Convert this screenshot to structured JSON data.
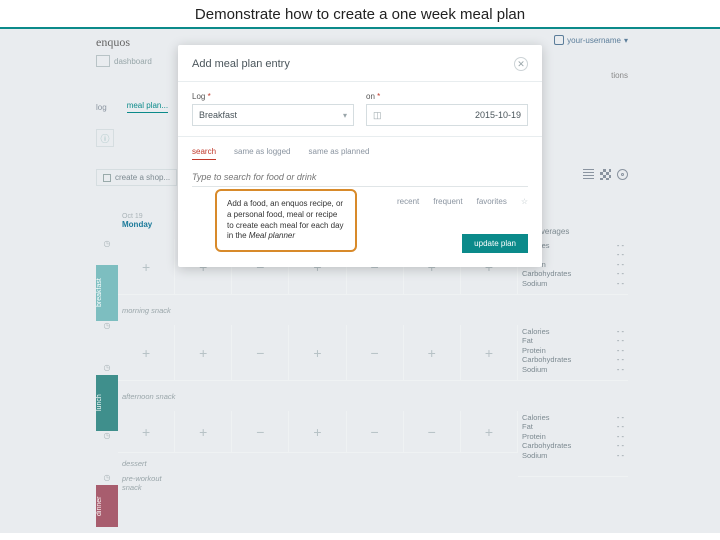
{
  "slide": {
    "title": "Demonstrate how to create a one week meal plan"
  },
  "app": {
    "brand": "enquos",
    "dashboard": "dashboard",
    "username": "your-username",
    "tions_fragment": "tions",
    "tabs": {
      "log": "log",
      "meal_plans": "meal plan..."
    },
    "shopping_btn": "create a shop...",
    "date_label": "Oct 19"
  },
  "days": {
    "monday": "Monday",
    "avg_header": "...k's averages"
  },
  "meals": {
    "morning_snack": "morning snack",
    "afternoon_snack": "afternoon snack",
    "dessert": "dessert",
    "pre_workout": "pre-workout snack"
  },
  "nutrients": {
    "calories": "Calories",
    "fat": "Fat",
    "protein": "Protein",
    "carbs": "Carbohydrates",
    "sodium": "Sodium",
    "dash": "- -"
  },
  "modal": {
    "title": "Add meal plan entry",
    "log_label": "Log",
    "on_label": "on",
    "req": "*",
    "log_value": "Breakfast",
    "date_value": "2015-10-19",
    "tab_search": "search",
    "tab_same_logged": "same as logged",
    "tab_same_planned": "same as planned",
    "search_placeholder": "Type to search for food or drink",
    "filter_recent": "recent",
    "filter_frequent": "frequent",
    "filter_favorites": "favorites",
    "update_btn": "update plan"
  },
  "callout": {
    "text_pre": "Add a food, an enquos recipe, or a personal food, meal or recipe to create each meal for each day in the ",
    "meal_planner": "Meal planner"
  }
}
